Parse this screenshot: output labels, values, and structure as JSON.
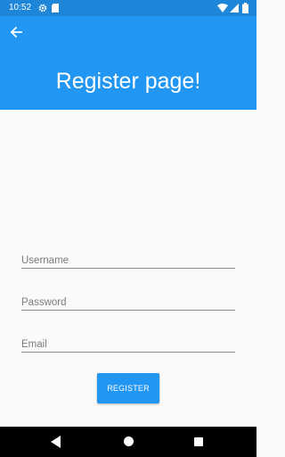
{
  "status_bar": {
    "time": "10:52",
    "icons": [
      "settings-icon",
      "sd-card-icon",
      "wifi-icon",
      "signal-icon",
      "battery-icon"
    ]
  },
  "app_bar": {
    "back_icon": "arrow-back-icon",
    "title": "Register page!",
    "color": "#2196f3"
  },
  "form": {
    "username_placeholder": "Username",
    "password_placeholder": "Password",
    "email_placeholder": "Email",
    "username_value": "",
    "password_value": "",
    "email_value": "",
    "register_label": "REGISTER"
  },
  "nav_bar": {
    "icons": [
      "nav-back-icon",
      "nav-home-icon",
      "nav-recents-icon"
    ]
  }
}
